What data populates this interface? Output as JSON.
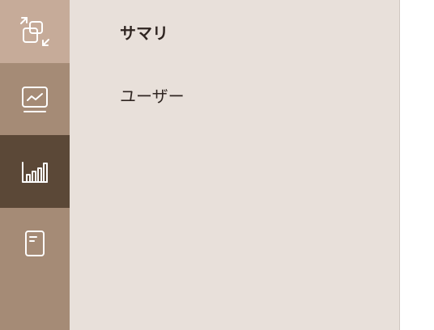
{
  "rail": {
    "items": [
      {
        "icon": "swap-screens-icon"
      },
      {
        "icon": "dashboard-chart-icon"
      },
      {
        "icon": "bar-chart-icon",
        "active": true
      },
      {
        "icon": "document-icon"
      }
    ]
  },
  "submenu": {
    "items": [
      {
        "label": "サマリ",
        "selected": true
      },
      {
        "label": "ユーザー"
      }
    ]
  },
  "colors": {
    "rail": "#a58b76",
    "rail_top": "#c6ab99",
    "rail_active": "#5b4837",
    "submenu_bg": "#e8e0da",
    "text": "#2f2521"
  }
}
